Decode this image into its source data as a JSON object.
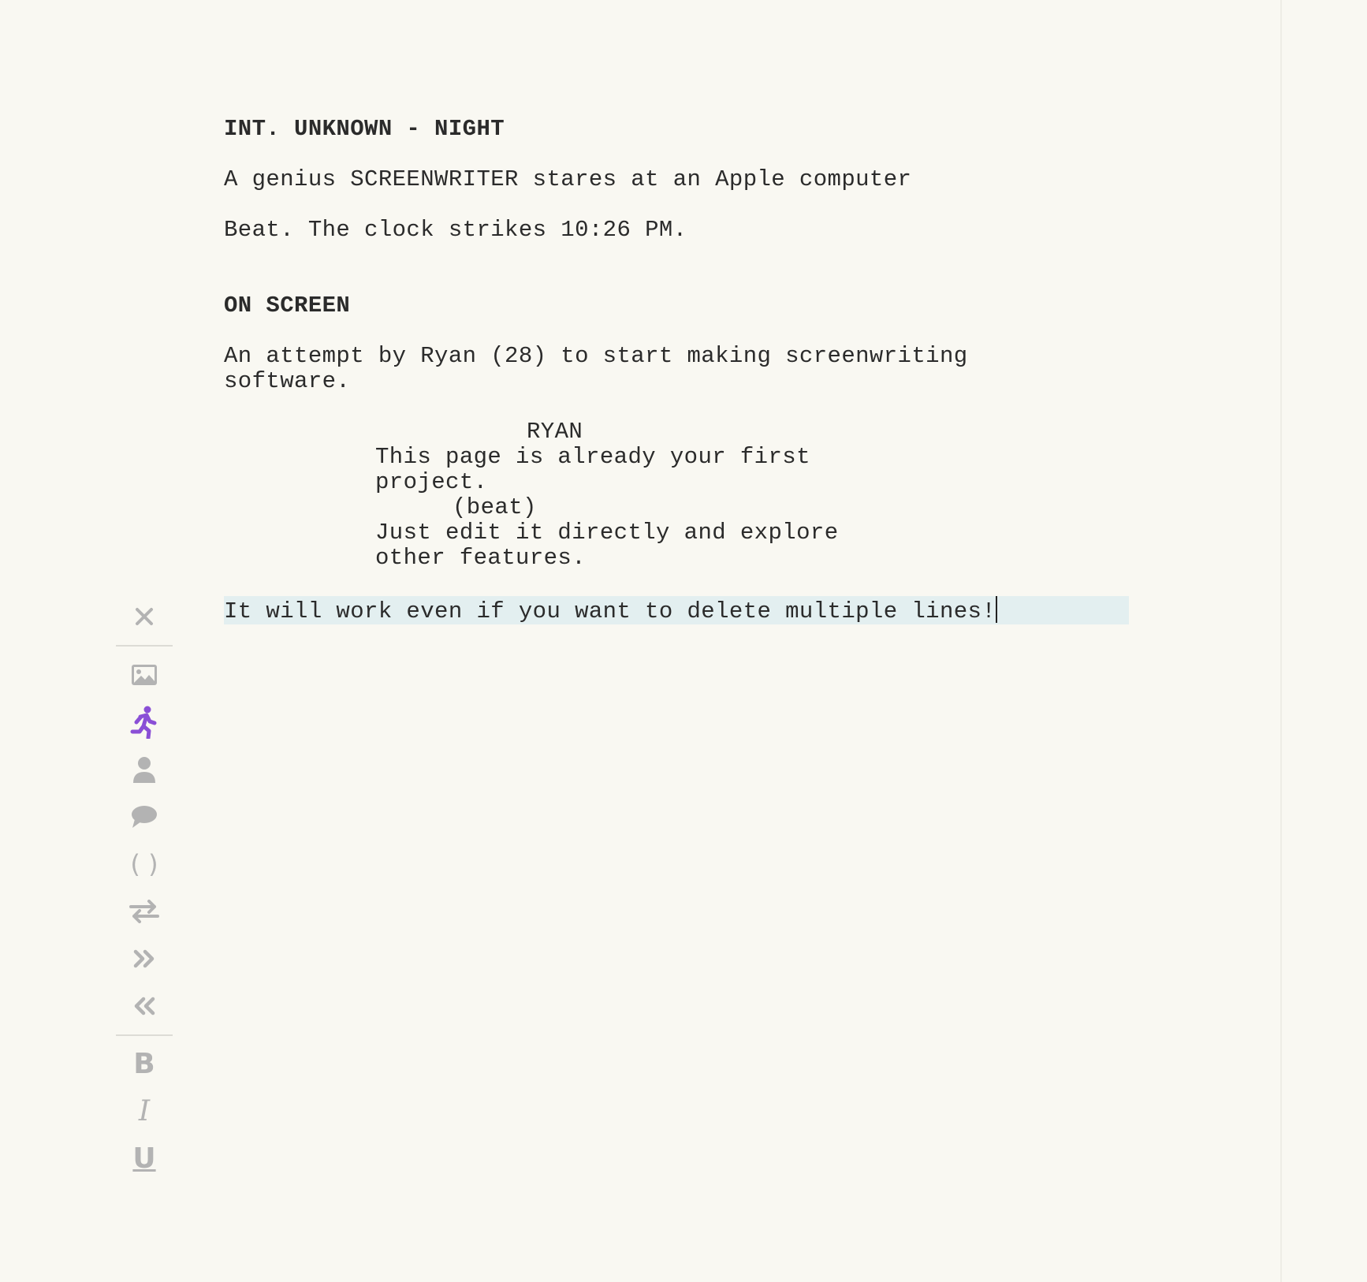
{
  "script": {
    "scene_heading_1": "INT. UNKNOWN - NIGHT",
    "action_1": "A genius SCREENWRITER stares at an Apple computer",
    "action_2": "Beat. The clock strikes 10:26 PM.",
    "scene_heading_2": "ON SCREEN",
    "action_3_line1": "An attempt by Ryan (28) to start making screenwriting",
    "action_3_line2": "software.",
    "character": "RYAN",
    "dialogue_1_line1": "This page is already your first",
    "dialogue_1_line2": "project.",
    "parenthetical": "(beat)",
    "dialogue_2_line1": "Just edit it directly and explore",
    "dialogue_2_line2": "other features.",
    "current_line": "It will work even if you want to delete multiple lines!"
  },
  "toolbar": {
    "items": [
      {
        "icon": "close-icon",
        "active": false
      },
      {
        "icon": "image-icon",
        "active": false
      },
      {
        "icon": "running-person-icon",
        "active": true
      },
      {
        "icon": "person-icon",
        "active": false
      },
      {
        "icon": "speech-bubble-icon",
        "active": false
      },
      {
        "icon": "parentheses-icon",
        "active": false
      },
      {
        "icon": "transition-arrows-icon",
        "active": false
      },
      {
        "icon": "indent-right-icon",
        "active": false
      },
      {
        "icon": "indent-left-icon",
        "active": false
      },
      {
        "icon": "bold-icon",
        "active": false
      },
      {
        "icon": "italic-icon",
        "active": false
      },
      {
        "icon": "underline-icon",
        "active": false
      }
    ],
    "labels": {
      "parentheses": "( )",
      "bold": "B",
      "italic": "I",
      "underline": "U"
    },
    "colors": {
      "active": "#8a4fd6",
      "inactive": "#b3b3b3"
    }
  }
}
